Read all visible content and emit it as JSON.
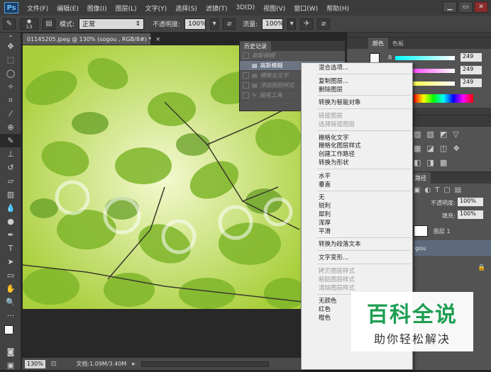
{
  "app": {
    "logo": "Ps"
  },
  "menubar": [
    "文件(F)",
    "编辑(E)",
    "图像(I)",
    "图层(L)",
    "文字(Y)",
    "选择(S)",
    "滤镜(T)",
    "3D(D)",
    "视图(V)",
    "窗口(W)",
    "帮助(H)"
  ],
  "window_controls": {
    "minimize": "▁",
    "restore": "▭",
    "close": "✕"
  },
  "options": {
    "brush_size": "13",
    "mode_label": "模式:",
    "mode_value": "正常",
    "opacity_label": "不透明度:",
    "opacity_value": "100%",
    "flow_label": "流量:",
    "flow_value": "100%"
  },
  "document": {
    "tab_title": "01145205.jpeg @ 130% (sogou , RGB/8#) *",
    "zoom": "130%",
    "doc_info": "文档:1.09M/3.40M"
  },
  "history": {
    "tab": "历史记录",
    "rows": [
      {
        "label": "高斯模糊",
        "state": "dim"
      },
      {
        "label": "高斯模糊",
        "state": "sel"
      },
      {
        "label": "栅格化文字",
        "state": "dim"
      },
      {
        "label": "添加图层样式",
        "state": "dim"
      },
      {
        "label": "画笔工具",
        "state": "dim"
      }
    ]
  },
  "color_panel": {
    "tabs": [
      "颜色",
      "色板"
    ],
    "r_label": "R",
    "r": "249",
    "g": "249",
    "b": "249"
  },
  "layers_panel": {
    "tab": "路径",
    "opacity_label": "不透明度:",
    "opacity": "100%",
    "fill_label": "填充:",
    "fill": "100%",
    "layer1": "图层 1",
    "layer_sogou": "gou"
  },
  "context_menu": [
    {
      "label": "混合选项...",
      "disabled": false
    },
    {
      "sep": true
    },
    {
      "label": "复制图层...",
      "disabled": false
    },
    {
      "label": "删除图层",
      "disabled": false
    },
    {
      "sep": true
    },
    {
      "label": "转换为智能对象",
      "disabled": false
    },
    {
      "sep": true
    },
    {
      "label": "链接图层",
      "disabled": true
    },
    {
      "label": "选择链接图层",
      "disabled": true
    },
    {
      "sep": true
    },
    {
      "label": "栅格化文字",
      "disabled": false
    },
    {
      "label": "栅格化图层样式",
      "disabled": false
    },
    {
      "label": "创建工作路径",
      "disabled": false
    },
    {
      "label": "转换为形状",
      "disabled": false
    },
    {
      "sep": true
    },
    {
      "label": "水平",
      "disabled": false
    },
    {
      "label": "垂直",
      "disabled": false
    },
    {
      "sep": true
    },
    {
      "label": "无",
      "disabled": false
    },
    {
      "label": "锐利",
      "disabled": false
    },
    {
      "label": "犀利",
      "disabled": false
    },
    {
      "label": "浑厚",
      "disabled": false
    },
    {
      "label": "平滑",
      "disabled": false
    },
    {
      "sep": true
    },
    {
      "label": "转换为段落文本",
      "disabled": false
    },
    {
      "sep": true
    },
    {
      "label": "文字变形...",
      "disabled": false
    },
    {
      "sep": true
    },
    {
      "label": "拷贝图层样式",
      "disabled": true
    },
    {
      "label": "粘贴图层样式",
      "disabled": true
    },
    {
      "label": "清除图层样式",
      "disabled": true
    },
    {
      "sep": true
    },
    {
      "label": "无颜色",
      "disabled": false
    },
    {
      "label": "红色",
      "disabled": false
    },
    {
      "label": "橙色",
      "disabled": false
    }
  ],
  "watermark": {
    "title": "百科全说",
    "subtitle": "助你轻松解决"
  },
  "colors": {
    "accent": "#6fbef5",
    "watermark_green": "#1d9e52"
  }
}
